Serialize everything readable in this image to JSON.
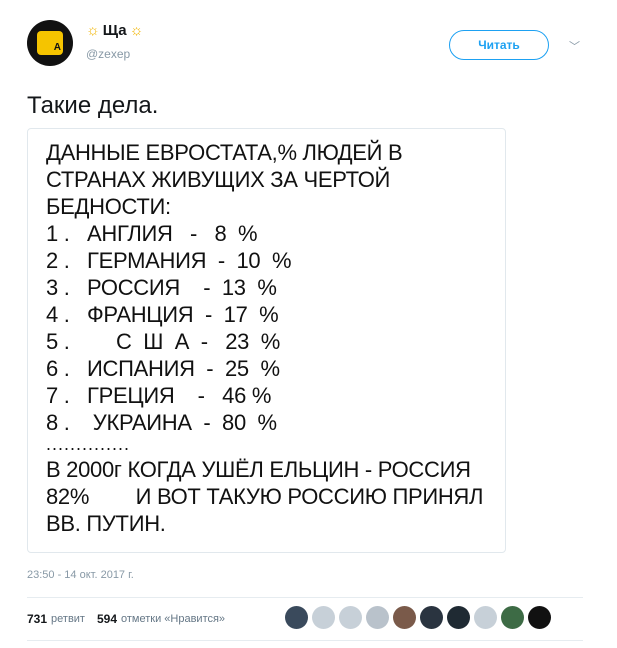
{
  "header": {
    "display_name": "Ща",
    "handle": "@zexep",
    "follow_label": "Читать",
    "avatar_letter": "А"
  },
  "tweet": {
    "text": "Такие дела."
  },
  "media": {
    "lines": [
      "ДАННЫЕ ЕВРОСТАТА,% ЛЮДЕЙ В",
      "СТРАНАХ ЖИВУЩИХ ЗА ЧЕРТОЙ",
      "БЕДНОСТИ:",
      "1 .   АНГЛИЯ   -   8  %",
      "2 .   ГЕРМАНИЯ  -  10  %",
      "3 .   РОССИЯ    -  13  %",
      "4 .   ФРАНЦИЯ  -  17  %",
      "5 .        С  Ш  А  -   23  %",
      "6 .   ИСПАНИЯ  -  25  %",
      "7 .   ГРЕЦИЯ    -   46 %",
      "8 .    УКРАИНА  -  80  %",
      "..............",
      "В 2000г КОГДА УШЁЛ ЕЛЬЦИН - РОССИЯ",
      "82%        И ВОТ ТАКУЮ РОССИЮ ПРИНЯЛ",
      "ВВ. ПУТИН."
    ]
  },
  "meta": {
    "timestamp": "23:50 - 14 окт. 2017 г."
  },
  "stats": {
    "retweets_count": "731",
    "retweets_label": "ретвит",
    "likes_count": "594",
    "likes_label": "отметки «Нравится»"
  },
  "likers": [
    {
      "color": "#3a4a5c",
      "icon": "avatar"
    },
    {
      "color": "#c7d0d8",
      "icon": "default-egg"
    },
    {
      "color": "#c7d0d8",
      "icon": "default-egg"
    },
    {
      "color": "#b9c2cb",
      "icon": "default-egg"
    },
    {
      "color": "#7a5a4a",
      "icon": "avatar"
    },
    {
      "color": "#2a3440",
      "icon": "avatar"
    },
    {
      "color": "#1f2a33",
      "icon": "avatar"
    },
    {
      "color": "#c7d0d8",
      "icon": "default-egg"
    },
    {
      "color": "#3d6b45",
      "icon": "avatar"
    },
    {
      "color": "#111111",
      "icon": "avatar"
    }
  ],
  "colors": {
    "accent": "#1da1f2",
    "muted": "#8899a6",
    "text": "#14171a"
  }
}
